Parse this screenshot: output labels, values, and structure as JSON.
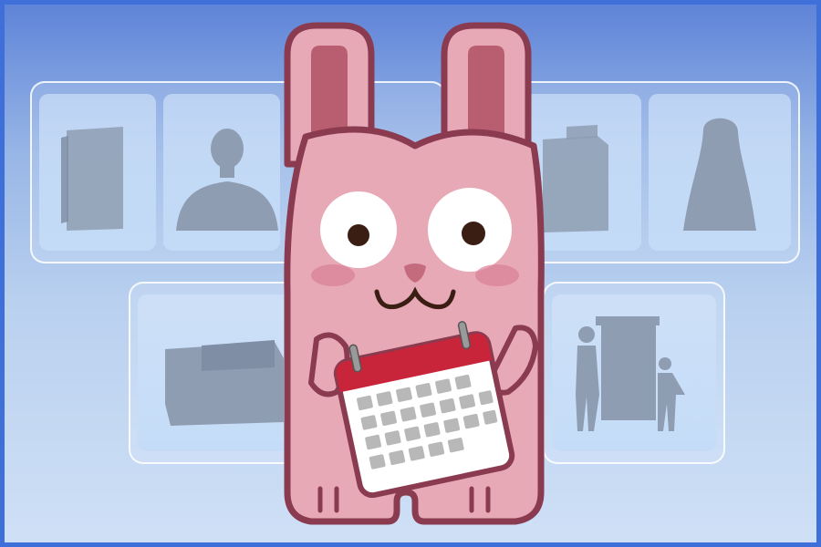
{
  "colors": {
    "frame_border": "#3f6fd8",
    "background_top": "#5f84d8",
    "background_bottom": "#cfe0f6",
    "silhouette": "#8e9db2",
    "bunny_body": "#e8a9b6",
    "bunny_outline": "#8a3b50",
    "bunny_inner_ear": "#b85e70",
    "calendar_header": "#c8243a",
    "calendar_page": "#ffffff",
    "calendar_cells": "#b8b8b8"
  },
  "background_tiles": [
    {
      "depicts": "furniture-silhouette"
    },
    {
      "depicts": "man-silhouette"
    },
    {
      "depicts": "furniture-silhouette"
    },
    {
      "depicts": "woman-silhouette"
    },
    {
      "depicts": "sofa-silhouette"
    },
    {
      "depicts": "family-with-furniture-silhouette"
    }
  ],
  "mascot": {
    "character": "pink-bunny",
    "holding": "calendar-icon"
  }
}
